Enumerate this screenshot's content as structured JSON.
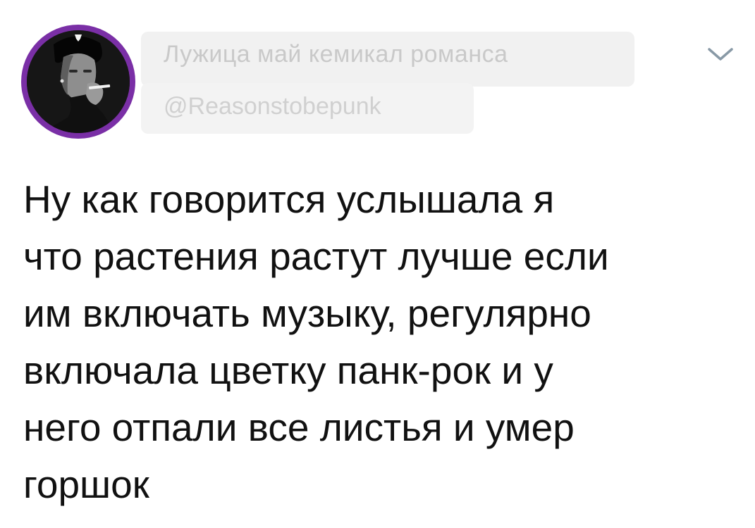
{
  "author": {
    "display_name": "Лужица май кемикал романса",
    "handle": "@Reasonstobepunk",
    "avatar_ring_color": "#7a2fa6"
  },
  "tweet": {
    "text_lines": [
      "Ну как говорится услышала я",
      "что растения растут лучше если",
      "им включать музыку, регулярно",
      "включала цветку панк-рок и у",
      "него отпали все листья и умер",
      "горшок"
    ]
  },
  "icons": {
    "more_menu": "chevron-down-icon"
  }
}
